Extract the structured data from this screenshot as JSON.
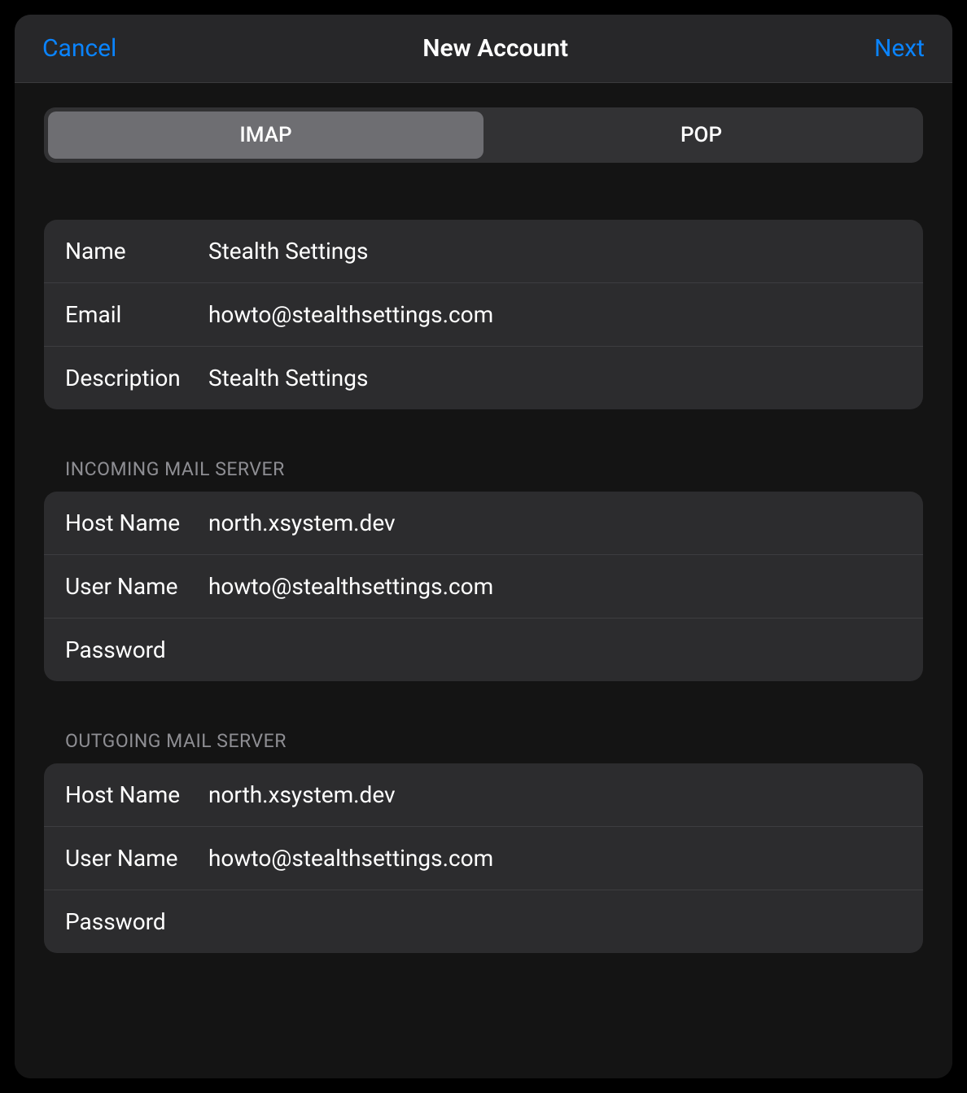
{
  "header": {
    "cancel": "Cancel",
    "title": "New Account",
    "next": "Next"
  },
  "segments": {
    "imap": "IMAP",
    "pop": "POP"
  },
  "account": {
    "name_label": "Name",
    "name_value": "Stealth Settings",
    "email_label": "Email",
    "email_value": "howto@stealthsettings.com",
    "description_label": "Description",
    "description_value": "Stealth Settings"
  },
  "incoming": {
    "header": "Incoming Mail Server",
    "host_label": "Host Name",
    "host_value": "north.xsystem.dev",
    "user_label": "User Name",
    "user_value": "howto@stealthsettings.com",
    "password_label": "Password",
    "password_value": ""
  },
  "outgoing": {
    "header": "Outgoing Mail Server",
    "host_label": "Host Name",
    "host_value": "north.xsystem.dev",
    "user_label": "User Name",
    "user_value": "howto@stealthsettings.com",
    "password_label": "Password",
    "password_value": ""
  }
}
